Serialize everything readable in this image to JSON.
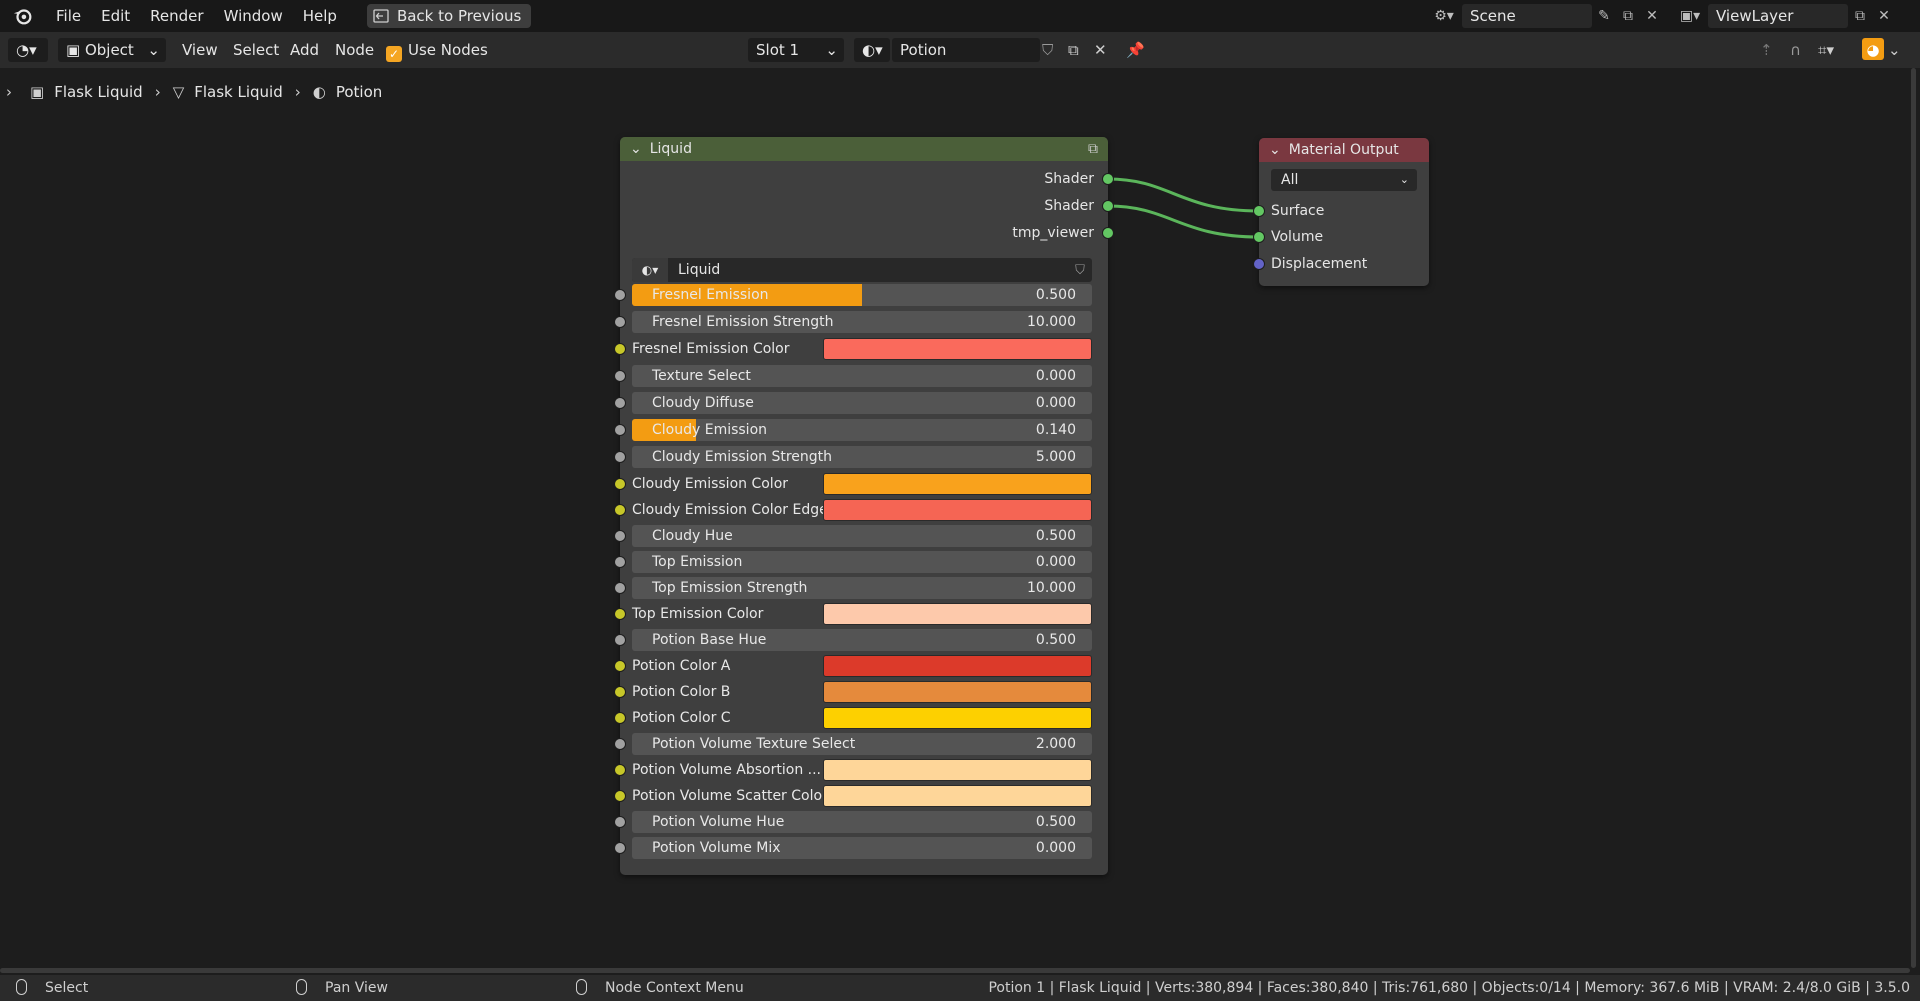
{
  "topbar": {
    "menu": [
      "File",
      "Edit",
      "Render",
      "Window",
      "Help"
    ],
    "back_button": "Back to Previous",
    "scene": "Scene",
    "view_layer": "ViewLayer"
  },
  "header": {
    "mode": "Object",
    "menus": [
      "View",
      "Select",
      "Add",
      "Node"
    ],
    "use_nodes_label": "Use Nodes",
    "use_nodes_checked": true,
    "slot": "Slot 1",
    "material": "Potion"
  },
  "breadcrumb": [
    "Flask Liquid",
    "Flask Liquid",
    "Potion"
  ],
  "liquid_node": {
    "title": "Liquid",
    "outputs": [
      "Shader",
      "Shader",
      "tmp_viewer"
    ],
    "node_group": "Liquid",
    "inputs": [
      {
        "label": "Fresnel Emission",
        "type": "number",
        "value": "0.500",
        "fill": 0.5
      },
      {
        "label": "Fresnel Emission Strength",
        "type": "number",
        "value": "10.000",
        "fill": 0
      },
      {
        "label": "Fresnel Emission Color",
        "type": "color",
        "color": "#fa6a5c"
      },
      {
        "label": "Texture Select",
        "type": "number",
        "value": "0.000",
        "fill": 0
      },
      {
        "label": "Cloudy Diffuse",
        "type": "number",
        "value": "0.000",
        "fill": 0
      },
      {
        "label": "Cloudy Emission",
        "type": "number",
        "value": "0.140",
        "fill": 0.14
      },
      {
        "label": "Cloudy Emission Strength",
        "type": "number",
        "value": "5.000",
        "fill": 0
      },
      {
        "label": "Cloudy Emission Color",
        "type": "color",
        "color": "#f9a21c"
      },
      {
        "label": "Cloudy Emission Color Edge",
        "type": "color",
        "color": "#f56554"
      },
      {
        "label": "Cloudy Hue",
        "type": "number",
        "value": "0.500",
        "fill": 0
      },
      {
        "label": "Top Emission",
        "type": "number",
        "value": "0.000",
        "fill": 0
      },
      {
        "label": "Top Emission Strength",
        "type": "number",
        "value": "10.000",
        "fill": 0
      },
      {
        "label": "Top Emission Color",
        "type": "color",
        "color": "#fdc9ab"
      },
      {
        "label": "Potion Base Hue",
        "type": "number",
        "value": "0.500",
        "fill": 0
      },
      {
        "label": "Potion Color A",
        "type": "color",
        "color": "#dc3a2a"
      },
      {
        "label": "Potion Color B",
        "type": "color",
        "color": "#e58a3c"
      },
      {
        "label": "Potion Color C",
        "type": "color",
        "color": "#fdd000"
      },
      {
        "label": "Potion Volume Texture Select",
        "type": "number",
        "value": "2.000",
        "fill": 0
      },
      {
        "label": "Potion Volume Absortion ...",
        "type": "color",
        "color": "#fed699"
      },
      {
        "label": "Potion Volume Scatter Color",
        "type": "color",
        "color": "#fed699"
      },
      {
        "label": "Potion Volume Hue",
        "type": "number",
        "value": "0.500",
        "fill": 0
      },
      {
        "label": "Potion Volume Mix",
        "type": "number",
        "value": "0.000",
        "fill": 0
      }
    ]
  },
  "output_node": {
    "title": "Material Output",
    "target": "All",
    "inputs": [
      "Surface",
      "Volume",
      "Displacement"
    ]
  },
  "statusbar": {
    "select": "Select",
    "pan": "Pan View",
    "context": "Node Context Menu",
    "stats": "Potion 1 | Flask Liquid | Verts:380,894 | Faces:380,840 | Tris:761,680 | Objects:0/14 | Memory: 367.6 MiB | VRAM: 2.4/8.0 GiB | 3.5.0"
  },
  "colors": {
    "accent": "#f39c12",
    "shader_socket": "#63c763",
    "color_socket": "#c7c729",
    "value_socket": "#a1a1a1",
    "vector_socket": "#6363c7"
  }
}
